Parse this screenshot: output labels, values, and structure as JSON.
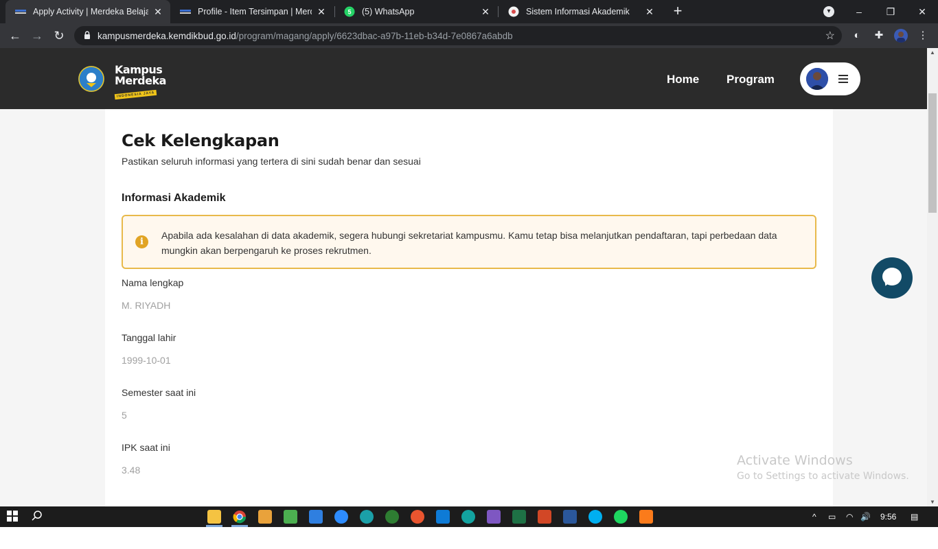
{
  "browser": {
    "tabs": [
      {
        "title": "Apply Activity | Merdeka Belajar -",
        "close": "✕",
        "active": true
      },
      {
        "title": "Profile - Item Tersimpan | Merdek",
        "close": "✕",
        "active": false
      },
      {
        "title": "(5) WhatsApp",
        "close": "✕",
        "active": false
      },
      {
        "title": "Sistem Informasi Akademik",
        "close": "✕",
        "active": false
      }
    ],
    "new_tab": "+",
    "whatsapp_badge": "5",
    "window_controls": {
      "menu": "▾",
      "minimize": "–",
      "restore": "❐",
      "close": "✕"
    },
    "nav": {
      "back": "←",
      "forward": "→",
      "reload": "↻"
    },
    "url_domain": "kampusmerdeka.kemdikbud.go.id",
    "url_path": "/program/magang/apply/6623dbac-a97b-11eb-b34d-7e0867a6abdb",
    "bookmark": "☆",
    "extensions": [
      "◐",
      "✚"
    ],
    "more": "⋮"
  },
  "site": {
    "logo_line1": "Kampus",
    "logo_line2": "Merdeka",
    "logo_sub": "INDONESIA JAYA",
    "nav": {
      "home": "Home",
      "program": "Program"
    }
  },
  "form": {
    "title": "Cek Kelengkapan",
    "subtitle": "Pastikan seluruh informasi yang tertera di sini sudah benar dan sesuai",
    "section_title": "Informasi Akademik",
    "alert_icon": "i",
    "alert_text": "Apabila ada kesalahan di data akademik, segera hubungi sekretariat kampusmu. Kamu tetap bisa melanjutkan pendaftaran, tapi perbedaan data mungkin akan berpengaruh ke proses rekrutmen.",
    "fields": [
      {
        "label": "Nama lengkap",
        "value": "M. RIYADH"
      },
      {
        "label": "Tanggal lahir",
        "value": "1999-10-01"
      },
      {
        "label": "Semester saat ini",
        "value": "5"
      },
      {
        "label": "IPK saat ini",
        "value": "3.48"
      }
    ]
  },
  "watermark": {
    "line1": "Activate Windows",
    "line2": "Go to Settings to activate Windows."
  },
  "taskbar": {
    "time": "9:56",
    "tray_chevron": "^",
    "volume": "🔊"
  },
  "colors": {
    "header_bg": "#2b2b2b",
    "alert_border": "#e8b94a",
    "alert_bg": "#fff8ee",
    "chat_fab": "#124a66"
  }
}
